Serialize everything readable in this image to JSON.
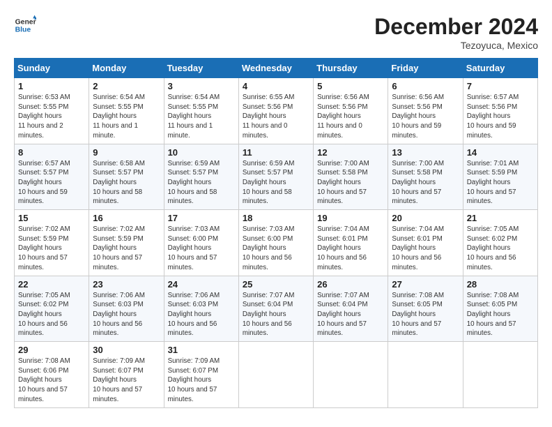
{
  "logo": {
    "line1": "General",
    "line2": "Blue"
  },
  "title": "December 2024",
  "location": "Tezoyuca, Mexico",
  "weekdays": [
    "Sunday",
    "Monday",
    "Tuesday",
    "Wednesday",
    "Thursday",
    "Friday",
    "Saturday"
  ],
  "weeks": [
    [
      {
        "day": "1",
        "sunrise": "6:53 AM",
        "sunset": "5:55 PM",
        "daylight": "11 hours and 2 minutes."
      },
      {
        "day": "2",
        "sunrise": "6:54 AM",
        "sunset": "5:55 PM",
        "daylight": "11 hours and 1 minute."
      },
      {
        "day": "3",
        "sunrise": "6:54 AM",
        "sunset": "5:55 PM",
        "daylight": "11 hours and 1 minute."
      },
      {
        "day": "4",
        "sunrise": "6:55 AM",
        "sunset": "5:56 PM",
        "daylight": "11 hours and 0 minutes."
      },
      {
        "day": "5",
        "sunrise": "6:56 AM",
        "sunset": "5:56 PM",
        "daylight": "11 hours and 0 minutes."
      },
      {
        "day": "6",
        "sunrise": "6:56 AM",
        "sunset": "5:56 PM",
        "daylight": "10 hours and 59 minutes."
      },
      {
        "day": "7",
        "sunrise": "6:57 AM",
        "sunset": "5:56 PM",
        "daylight": "10 hours and 59 minutes."
      }
    ],
    [
      {
        "day": "8",
        "sunrise": "6:57 AM",
        "sunset": "5:57 PM",
        "daylight": "10 hours and 59 minutes."
      },
      {
        "day": "9",
        "sunrise": "6:58 AM",
        "sunset": "5:57 PM",
        "daylight": "10 hours and 58 minutes."
      },
      {
        "day": "10",
        "sunrise": "6:59 AM",
        "sunset": "5:57 PM",
        "daylight": "10 hours and 58 minutes."
      },
      {
        "day": "11",
        "sunrise": "6:59 AM",
        "sunset": "5:57 PM",
        "daylight": "10 hours and 58 minutes."
      },
      {
        "day": "12",
        "sunrise": "7:00 AM",
        "sunset": "5:58 PM",
        "daylight": "10 hours and 57 minutes."
      },
      {
        "day": "13",
        "sunrise": "7:00 AM",
        "sunset": "5:58 PM",
        "daylight": "10 hours and 57 minutes."
      },
      {
        "day": "14",
        "sunrise": "7:01 AM",
        "sunset": "5:59 PM",
        "daylight": "10 hours and 57 minutes."
      }
    ],
    [
      {
        "day": "15",
        "sunrise": "7:02 AM",
        "sunset": "5:59 PM",
        "daylight": "10 hours and 57 minutes."
      },
      {
        "day": "16",
        "sunrise": "7:02 AM",
        "sunset": "5:59 PM",
        "daylight": "10 hours and 57 minutes."
      },
      {
        "day": "17",
        "sunrise": "7:03 AM",
        "sunset": "6:00 PM",
        "daylight": "10 hours and 57 minutes."
      },
      {
        "day": "18",
        "sunrise": "7:03 AM",
        "sunset": "6:00 PM",
        "daylight": "10 hours and 56 minutes."
      },
      {
        "day": "19",
        "sunrise": "7:04 AM",
        "sunset": "6:01 PM",
        "daylight": "10 hours and 56 minutes."
      },
      {
        "day": "20",
        "sunrise": "7:04 AM",
        "sunset": "6:01 PM",
        "daylight": "10 hours and 56 minutes."
      },
      {
        "day": "21",
        "sunrise": "7:05 AM",
        "sunset": "6:02 PM",
        "daylight": "10 hours and 56 minutes."
      }
    ],
    [
      {
        "day": "22",
        "sunrise": "7:05 AM",
        "sunset": "6:02 PM",
        "daylight": "10 hours and 56 minutes."
      },
      {
        "day": "23",
        "sunrise": "7:06 AM",
        "sunset": "6:03 PM",
        "daylight": "10 hours and 56 minutes."
      },
      {
        "day": "24",
        "sunrise": "7:06 AM",
        "sunset": "6:03 PM",
        "daylight": "10 hours and 56 minutes."
      },
      {
        "day": "25",
        "sunrise": "7:07 AM",
        "sunset": "6:04 PM",
        "daylight": "10 hours and 56 minutes."
      },
      {
        "day": "26",
        "sunrise": "7:07 AM",
        "sunset": "6:04 PM",
        "daylight": "10 hours and 57 minutes."
      },
      {
        "day": "27",
        "sunrise": "7:08 AM",
        "sunset": "6:05 PM",
        "daylight": "10 hours and 57 minutes."
      },
      {
        "day": "28",
        "sunrise": "7:08 AM",
        "sunset": "6:05 PM",
        "daylight": "10 hours and 57 minutes."
      }
    ],
    [
      {
        "day": "29",
        "sunrise": "7:08 AM",
        "sunset": "6:06 PM",
        "daylight": "10 hours and 57 minutes."
      },
      {
        "day": "30",
        "sunrise": "7:09 AM",
        "sunset": "6:07 PM",
        "daylight": "10 hours and 57 minutes."
      },
      {
        "day": "31",
        "sunrise": "7:09 AM",
        "sunset": "6:07 PM",
        "daylight": "10 hours and 57 minutes."
      },
      null,
      null,
      null,
      null
    ]
  ]
}
